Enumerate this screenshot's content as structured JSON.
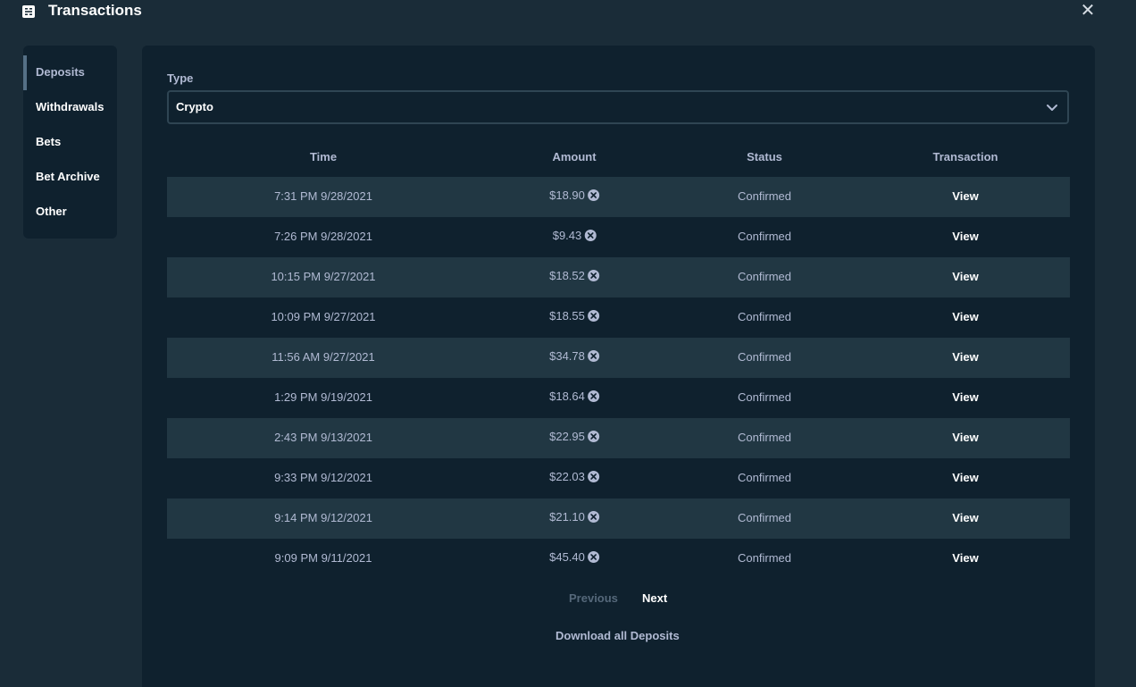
{
  "header": {
    "title": "Transactions",
    "icon": "transactions-icon",
    "close_icon": "close-icon",
    "close_glyph": "✕"
  },
  "sidebar": {
    "items": [
      {
        "label": "Deposits",
        "active": true
      },
      {
        "label": "Withdrawals",
        "active": false
      },
      {
        "label": "Bets",
        "active": false
      },
      {
        "label": "Bet Archive",
        "active": false
      },
      {
        "label": "Other",
        "active": false
      }
    ]
  },
  "filter": {
    "label": "Type",
    "selected": "Crypto"
  },
  "table": {
    "columns": [
      "Time",
      "Amount",
      "Status",
      "Transaction"
    ],
    "rows": [
      {
        "time": "7:31 PM 9/28/2021",
        "amount": "$18.90",
        "status": "Confirmed",
        "transaction": "View"
      },
      {
        "time": "7:26 PM 9/28/2021",
        "amount": "$9.43",
        "status": "Confirmed",
        "transaction": "View"
      },
      {
        "time": "10:15 PM 9/27/2021",
        "amount": "$18.52",
        "status": "Confirmed",
        "transaction": "View"
      },
      {
        "time": "10:09 PM 9/27/2021",
        "amount": "$18.55",
        "status": "Confirmed",
        "transaction": "View"
      },
      {
        "time": "11:56 AM 9/27/2021",
        "amount": "$34.78",
        "status": "Confirmed",
        "transaction": "View"
      },
      {
        "time": "1:29 PM 9/19/2021",
        "amount": "$18.64",
        "status": "Confirmed",
        "transaction": "View"
      },
      {
        "time": "2:43 PM 9/13/2021",
        "amount": "$22.95",
        "status": "Confirmed",
        "transaction": "View"
      },
      {
        "time": "9:33 PM 9/12/2021",
        "amount": "$22.03",
        "status": "Confirmed",
        "transaction": "View"
      },
      {
        "time": "9:14 PM 9/12/2021",
        "amount": "$21.10",
        "status": "Confirmed",
        "transaction": "View"
      },
      {
        "time": "9:09 PM 9/11/2021",
        "amount": "$45.40",
        "status": "Confirmed",
        "transaction": "View"
      }
    ]
  },
  "pagination": {
    "previous": "Previous",
    "next": "Next"
  },
  "download_label": "Download all Deposits",
  "colors": {
    "background": "#1a2c38",
    "panel": "#0f212e",
    "row_alt": "#213743",
    "muted_text": "#b1bad3",
    "border": "#2f4553"
  }
}
